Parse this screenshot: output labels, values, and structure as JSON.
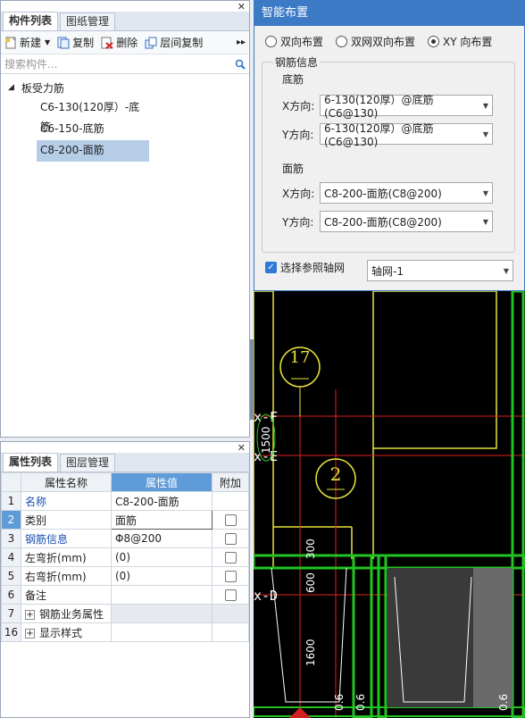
{
  "component_panel": {
    "tabs": [
      "构件列表",
      "图纸管理"
    ],
    "toolbar": {
      "new": "新建",
      "copy": "复制",
      "delete": "删除",
      "floor_copy": "层间复制"
    },
    "search_placeholder": "搜索构件...",
    "tree": {
      "root": "板受力筋",
      "items": [
        "C6-130(120厚）-底筋",
        "C6-150-底筋",
        "C8-200-面筋"
      ]
    }
  },
  "property_panel": {
    "tabs": [
      "属性列表",
      "图层管理"
    ],
    "headers": {
      "name": "属性名称",
      "value": "属性值",
      "extra": "附加"
    },
    "rows": [
      {
        "num": "1",
        "name": "名称",
        "value": "C8-200-面筋"
      },
      {
        "num": "2",
        "name": "类别",
        "value": "面筋"
      },
      {
        "num": "3",
        "name": "钢筋信息",
        "value": "Φ8@200"
      },
      {
        "num": "4",
        "name": "左弯折(mm)",
        "value": "(0)"
      },
      {
        "num": "5",
        "name": "右弯折(mm)",
        "value": "(0)"
      },
      {
        "num": "6",
        "name": "备注",
        "value": ""
      },
      {
        "num": "7",
        "name": "钢筋业务属性",
        "value": ""
      },
      {
        "num": "16",
        "name": "显示样式",
        "value": ""
      }
    ]
  },
  "dialog": {
    "title": "智能布置",
    "options": [
      "双向布置",
      "双网双向布置",
      "XY 向布置"
    ],
    "selected_option": "XY 向布置",
    "group_title": "钢筋信息",
    "bottom_title": "底筋",
    "top_title": "面筋",
    "x_label": "X方向:",
    "y_label": "Y方向:",
    "bottom_x": "6-130(120厚）@底筋(C6@130)",
    "bottom_y": "6-130(120厚）@底筋(C6@130)",
    "top_x": "C8-200-面筋(C8@200)",
    "top_y": "C8-200-面筋(C8@200)",
    "axis_check_label": "选择参照轴网",
    "axis_value": "轴网-1"
  },
  "cad": {
    "axis_labels": [
      "17",
      "2"
    ],
    "grid_labels": [
      "x-F",
      "x-E",
      "x-D"
    ],
    "dims": [
      "1500",
      "300",
      "600",
      "1600",
      "0.6",
      "0.6",
      "0.6"
    ]
  },
  "colors": {
    "accent": "#3c7ac6",
    "selection": "#b6cde8",
    "header_highlight": "#5e9bd8",
    "cad_green": "#22c322",
    "cad_yellow": "#e8e23a",
    "cad_red": "#e02020"
  }
}
